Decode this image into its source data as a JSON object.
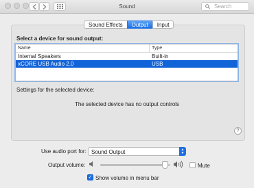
{
  "window": {
    "title": "Sound"
  },
  "search": {
    "placeholder": "Search"
  },
  "tabs": [
    {
      "label": "Sound Effects",
      "active": false
    },
    {
      "label": "Output",
      "active": true
    },
    {
      "label": "Input",
      "active": false
    }
  ],
  "output": {
    "heading": "Select a device for sound output:",
    "columns": {
      "name": "Name",
      "type": "Type"
    },
    "devices": [
      {
        "name": "Internal Speakers",
        "type": "Built-in",
        "selected": false
      },
      {
        "name": "xCORE USB Audio 2.0",
        "type": "USB",
        "selected": true
      }
    ],
    "settings_label": "Settings for the selected device:",
    "no_controls": "The selected device has no output controls"
  },
  "audio_port": {
    "label": "Use audio port for:",
    "value": "Sound Output"
  },
  "volume": {
    "label": "Output volume:",
    "level": 0.93,
    "mute_label": "Mute",
    "muted": false
  },
  "show_in_menubar": {
    "label": "Show volume in menu bar",
    "checked": true
  },
  "colors": {
    "accent": "#1163d8",
    "window_bg": "#ececec"
  },
  "icons": [
    "close-dot",
    "minimize-dot",
    "zoom-dot",
    "chevron-left-icon",
    "chevron-right-icon",
    "grid-icon",
    "search-icon",
    "help-icon",
    "speaker-low-icon",
    "speaker-high-icon",
    "checkmark-icon"
  ]
}
